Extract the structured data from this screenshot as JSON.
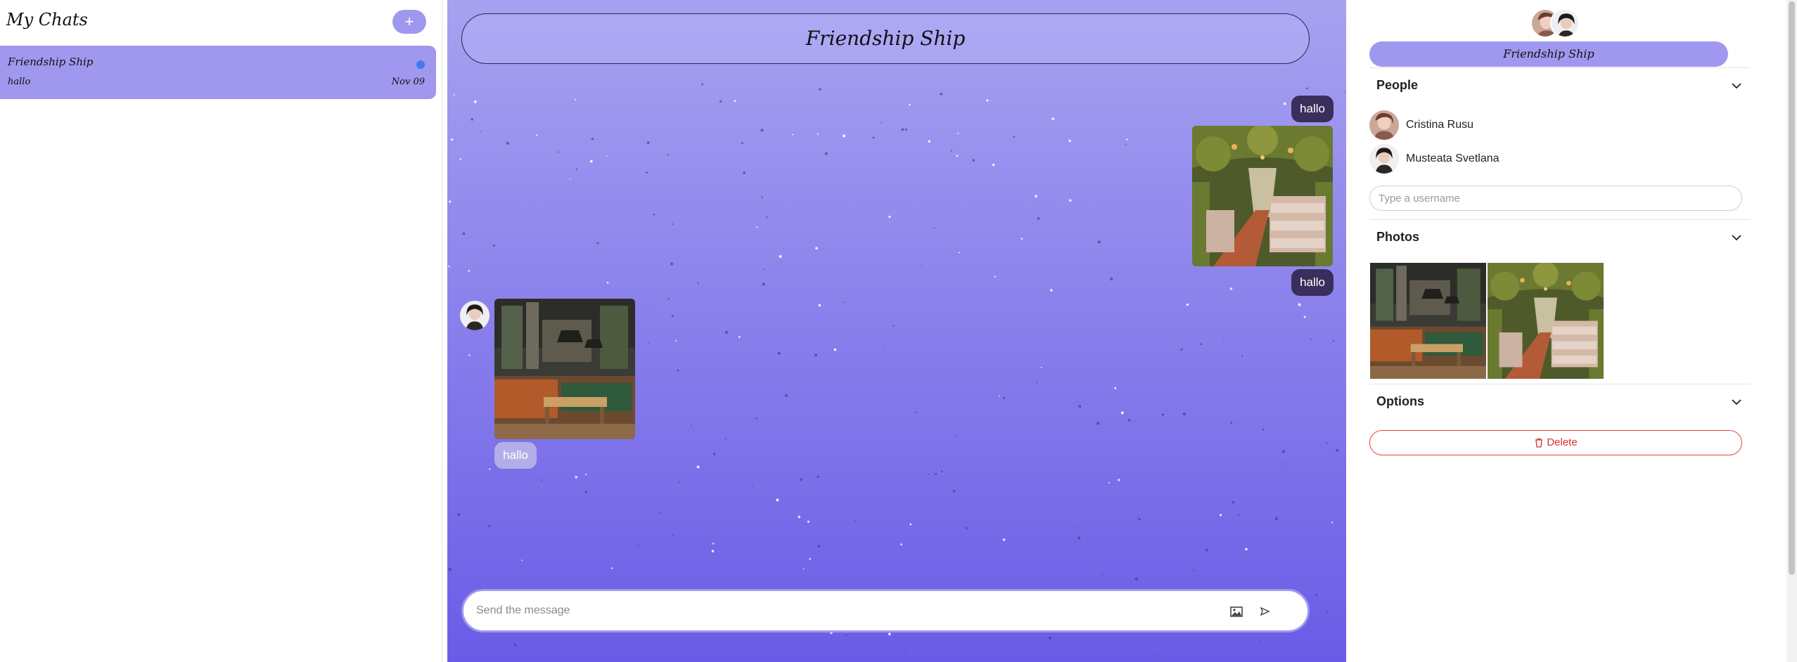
{
  "sidebar": {
    "title": "My Chats",
    "add_icon": "plus-icon",
    "chats": [
      {
        "name": "Friendship Ship",
        "preview": "hallo",
        "date": "Nov 09",
        "unread": true
      }
    ]
  },
  "chat": {
    "title": "Friendship Ship",
    "messages": [
      {
        "direction": "outgoing",
        "type": "text",
        "text": "hallo"
      },
      {
        "direction": "outgoing",
        "type": "image",
        "image": "restaurant-garden-photo"
      },
      {
        "direction": "outgoing",
        "type": "text",
        "text": "hallo"
      },
      {
        "direction": "incoming",
        "type": "image",
        "image": "restaurant-interior-photo"
      },
      {
        "direction": "incoming",
        "type": "text",
        "text": "hallo"
      }
    ],
    "composer": {
      "placeholder": "Send the message",
      "value": ""
    }
  },
  "details": {
    "group_name": "Friendship Ship",
    "sections": {
      "people": "People",
      "photos": "Photos",
      "options": "Options"
    },
    "people": [
      {
        "name": "Cristina Rusu"
      },
      {
        "name": "Musteata Svetlana"
      }
    ],
    "username_input": {
      "placeholder": "Type a username",
      "value": ""
    },
    "photos": [
      "restaurant-interior-photo",
      "restaurant-garden-photo"
    ],
    "delete_label": "Delete"
  },
  "colors": {
    "accent": "#9f98ee",
    "outgoing_bubble": "#3b2e5c",
    "incoming_bubble": "#b4aee8",
    "unread_dot": "#3d7cf0",
    "danger": "#e0453e"
  }
}
